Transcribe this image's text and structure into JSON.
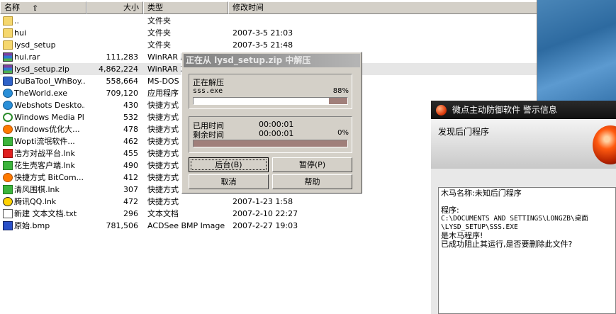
{
  "filelist": {
    "headers": {
      "name": "名称",
      "size": "大小",
      "type": "类型",
      "modified": "修改时间"
    },
    "rows": [
      {
        "icon": "folder-icon",
        "name": "..",
        "size": "",
        "type": "文件夹",
        "date": ""
      },
      {
        "icon": "folder-icon",
        "name": "hui",
        "size": "",
        "type": "文件夹",
        "date": "2007-3-5 21:03"
      },
      {
        "icon": "folder-icon",
        "name": "lysd_setup",
        "size": "",
        "type": "文件夹",
        "date": "2007-3-5 21:48"
      },
      {
        "icon": "rar-icon",
        "name": "hui.rar",
        "size": "111,283",
        "type": "WinRAR 压",
        "date": ""
      },
      {
        "icon": "rar-icon",
        "name": "lysd_setup.zip",
        "size": "4,862,224",
        "type": "WinRAR Z",
        "date": ""
      },
      {
        "icon": "exe-icon",
        "name": "DuBaTool_WhBoy...",
        "size": "558,664",
        "type": "MS-DOS 扌",
        "date": ""
      },
      {
        "icon": "globe-icon",
        "name": "TheWorld.exe",
        "size": "709,120",
        "type": "应用程序",
        "date": ""
      },
      {
        "icon": "globe-icon",
        "name": "Webshots Deskto...",
        "size": "430",
        "type": "快捷方式",
        "date": ""
      },
      {
        "icon": "media-player-icon",
        "name": "Windows Media Pl...",
        "size": "532",
        "type": "快捷方式",
        "date": ""
      },
      {
        "icon": "windows-optimizer-icon",
        "name": "Windows优化大...",
        "size": "478",
        "type": "快捷方式",
        "date": ""
      },
      {
        "icon": "wopti-icon",
        "name": "Wopti流氓软件...",
        "size": "462",
        "type": "快捷方式",
        "date": ""
      },
      {
        "icon": "game-platform-icon",
        "name": "浩方对战平台.lnk",
        "size": "455",
        "type": "快捷方式",
        "date": ""
      },
      {
        "icon": "peanut-shell-icon",
        "name": "花生壳客户端.lnk",
        "size": "490",
        "type": "快捷方式",
        "date": ""
      },
      {
        "icon": "bitcomet-icon",
        "name": "快捷方式 BitCom...",
        "size": "412",
        "type": "快捷方式",
        "date": ""
      },
      {
        "icon": "go-game-icon",
        "name": "清风围棋.lnk",
        "size": "307",
        "type": "快捷方式",
        "date": ""
      },
      {
        "icon": "qq-icon",
        "name": "腾讯QQ.lnk",
        "size": "472",
        "type": "快捷方式",
        "date": "2007-1-23 1:58"
      },
      {
        "icon": "text-file-icon",
        "name": "新建 文本文档.txt",
        "size": "296",
        "type": "文本文档",
        "date": "2007-2-10 22:27"
      },
      {
        "icon": "bmp-file-icon",
        "name": "原始.bmp",
        "size": "781,506",
        "type": "ACDSee BMP Image",
        "date": "2007-2-27 19:03"
      }
    ]
  },
  "extract_dialog": {
    "title": "正在从 lysd_setup.zip 中解压",
    "status_label": "正在解压",
    "current_file": "sss.exe",
    "file_progress_label": "88%",
    "file_progress": 0.88,
    "elapsed_label": "已用时间",
    "elapsed": "00:00:01",
    "remaining_label": "剩余时间",
    "remaining": "00:00:01",
    "total_progress_label": "0%",
    "total_progress": 1.0,
    "buttons": {
      "background": "后台(B)",
      "pause": "暂停(P)",
      "cancel": "取消",
      "help": "帮助"
    }
  },
  "alert": {
    "title": "微点主动防御软件  警示信息",
    "message": "发现后门程序",
    "body_line1": "木马名称:未知后门程序",
    "body_line2": "程序:",
    "body_path": "C:\\DOCUMENTS AND SETTINGS\\LONGZB\\桌面\\LYSD_SETUP\\SSS.EXE",
    "body_line3": "是木马程序!",
    "body_line4": "已成功阻止其运行,是否要删除此文件?"
  }
}
